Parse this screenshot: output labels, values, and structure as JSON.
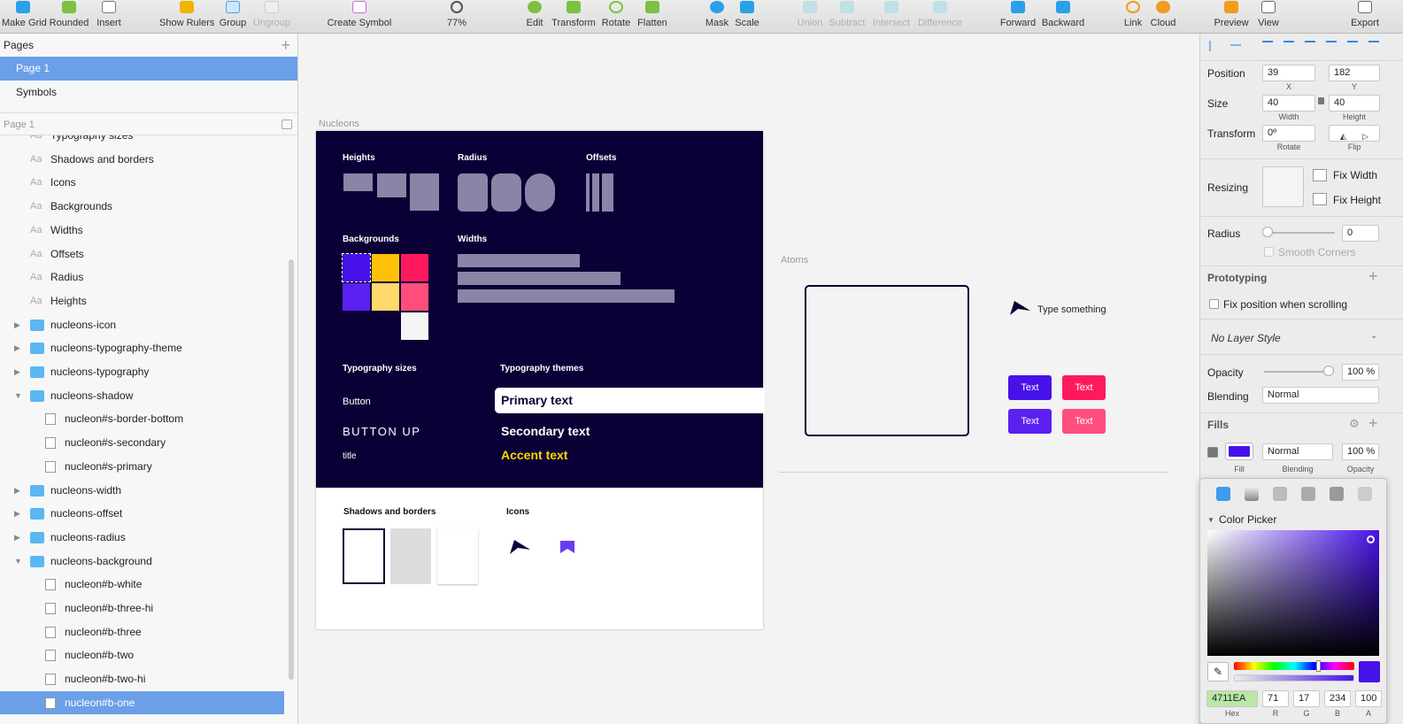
{
  "toolbar": {
    "make_grid": "Make Grid",
    "rounded": "Rounded",
    "insert": "Insert",
    "show_rulers": "Show Rulers",
    "group": "Group",
    "ungroup": "Ungroup",
    "create_symbol": "Create Symbol",
    "zoom": "77%",
    "edit": "Edit",
    "transform": "Transform",
    "rotate": "Rotate",
    "flatten": "Flatten",
    "mask": "Mask",
    "scale": "Scale",
    "union": "Union",
    "subtract": "Subtract",
    "intersect": "Intersect",
    "difference": "Difference",
    "forward": "Forward",
    "backward": "Backward",
    "link": "Link",
    "cloud": "Cloud",
    "preview": "Preview",
    "view": "View",
    "export": "Export"
  },
  "pages": {
    "title": "Pages",
    "items": [
      "Page 1",
      "Symbols"
    ],
    "section": "Page 1"
  },
  "layers": [
    {
      "kind": "text",
      "label": "Typography sizes"
    },
    {
      "kind": "text",
      "label": "Shadows and borders"
    },
    {
      "kind": "text",
      "label": "Icons"
    },
    {
      "kind": "text",
      "label": "Backgrounds"
    },
    {
      "kind": "text",
      "label": "Widths"
    },
    {
      "kind": "text",
      "label": "Offsets"
    },
    {
      "kind": "text",
      "label": "Radius"
    },
    {
      "kind": "text",
      "label": "Heights"
    },
    {
      "kind": "folder",
      "label": "nucleons-icon",
      "open": false
    },
    {
      "kind": "folder",
      "label": "nucleons-typography-theme",
      "open": false
    },
    {
      "kind": "folder",
      "label": "nucleons-typography",
      "open": false
    },
    {
      "kind": "folder",
      "label": "nucleons-shadow",
      "open": true
    },
    {
      "kind": "symbol",
      "label": "nucleon#s-border-bottom"
    },
    {
      "kind": "symbol",
      "label": "nucleon#s-secondary"
    },
    {
      "kind": "symbol",
      "label": "nucleon#s-primary"
    },
    {
      "kind": "folder",
      "label": "nucleons-width",
      "open": false
    },
    {
      "kind": "folder",
      "label": "nucleons-offset",
      "open": false
    },
    {
      "kind": "folder",
      "label": "nucleons-radius",
      "open": false
    },
    {
      "kind": "folder",
      "label": "nucleons-background",
      "open": true
    },
    {
      "kind": "symbol",
      "label": "nucleon#b-white"
    },
    {
      "kind": "symbol",
      "label": "nucleon#b-three-hi"
    },
    {
      "kind": "symbol",
      "label": "nucleon#b-three"
    },
    {
      "kind": "symbol",
      "label": "nucleon#b-two"
    },
    {
      "kind": "symbol",
      "label": "nucleon#b-two-hi"
    },
    {
      "kind": "symbol",
      "label": "nucleon#b-one",
      "selected": true
    }
  ],
  "canvas": {
    "nucleons_label": "Nucleons",
    "atoms_label": "Atoms",
    "heights": "Heights",
    "radius": "Radius",
    "offsets": "Offsets",
    "backgrounds": "Backgrounds",
    "widths": "Widths",
    "typography_sizes": "Typography sizes",
    "typography_themes": "Typography themes",
    "button": "Button",
    "button_up": "BUTTON UP",
    "title_small": "title",
    "primary_text": "Primary text",
    "secondary_text": "Secondary text",
    "accent_text": "Accent text",
    "shadows_borders": "Shadows and borders",
    "icons": "Icons",
    "type_something": "Type something",
    "btn_text": "Text",
    "colors": {
      "dark": "#0b0036",
      "violet": "#4711ea",
      "yellow": "#ffc107",
      "pink": "#ff1a5e",
      "yellow_hi": "#ffd86b",
      "pink_hi": "#ff4e7e",
      "white": "#f5f5f5",
      "accent": "#ffd600"
    }
  },
  "inspector": {
    "position": "Position",
    "x": "39",
    "y": "182",
    "x_lbl": "X",
    "y_lbl": "Y",
    "size": "Size",
    "width": "40",
    "height": "40",
    "width_lbl": "Width",
    "height_lbl": "Height",
    "transform": "Transform",
    "rotate_val": "0º",
    "rotate_lbl": "Rotate",
    "flip_lbl": "Flip",
    "resizing": "Resizing",
    "fix_width": "Fix Width",
    "fix_height": "Fix Height",
    "radius": "Radius",
    "radius_val": "0",
    "smooth_corners": "Smooth Corners",
    "prototyping": "Prototyping",
    "fix_scroll": "Fix position when scrolling",
    "layer_style": "No Layer Style",
    "opacity": "Opacity",
    "opacity_val": "100 %",
    "blending": "Blending",
    "blending_val": "Normal",
    "fills": "Fills",
    "fill_lbl": "Fill",
    "fill_blend": "Normal",
    "fill_blend_lbl": "Blending",
    "fill_opacity": "100 %",
    "fill_opacity_lbl": "Opacity",
    "color_picker": "Color Picker",
    "hex": "4711EA",
    "r": "71",
    "g": "17",
    "b": "234",
    "a": "100",
    "hex_lbl": "Hex",
    "r_lbl": "R",
    "g_lbl": "G",
    "b_lbl": "B",
    "a_lbl": "A"
  }
}
